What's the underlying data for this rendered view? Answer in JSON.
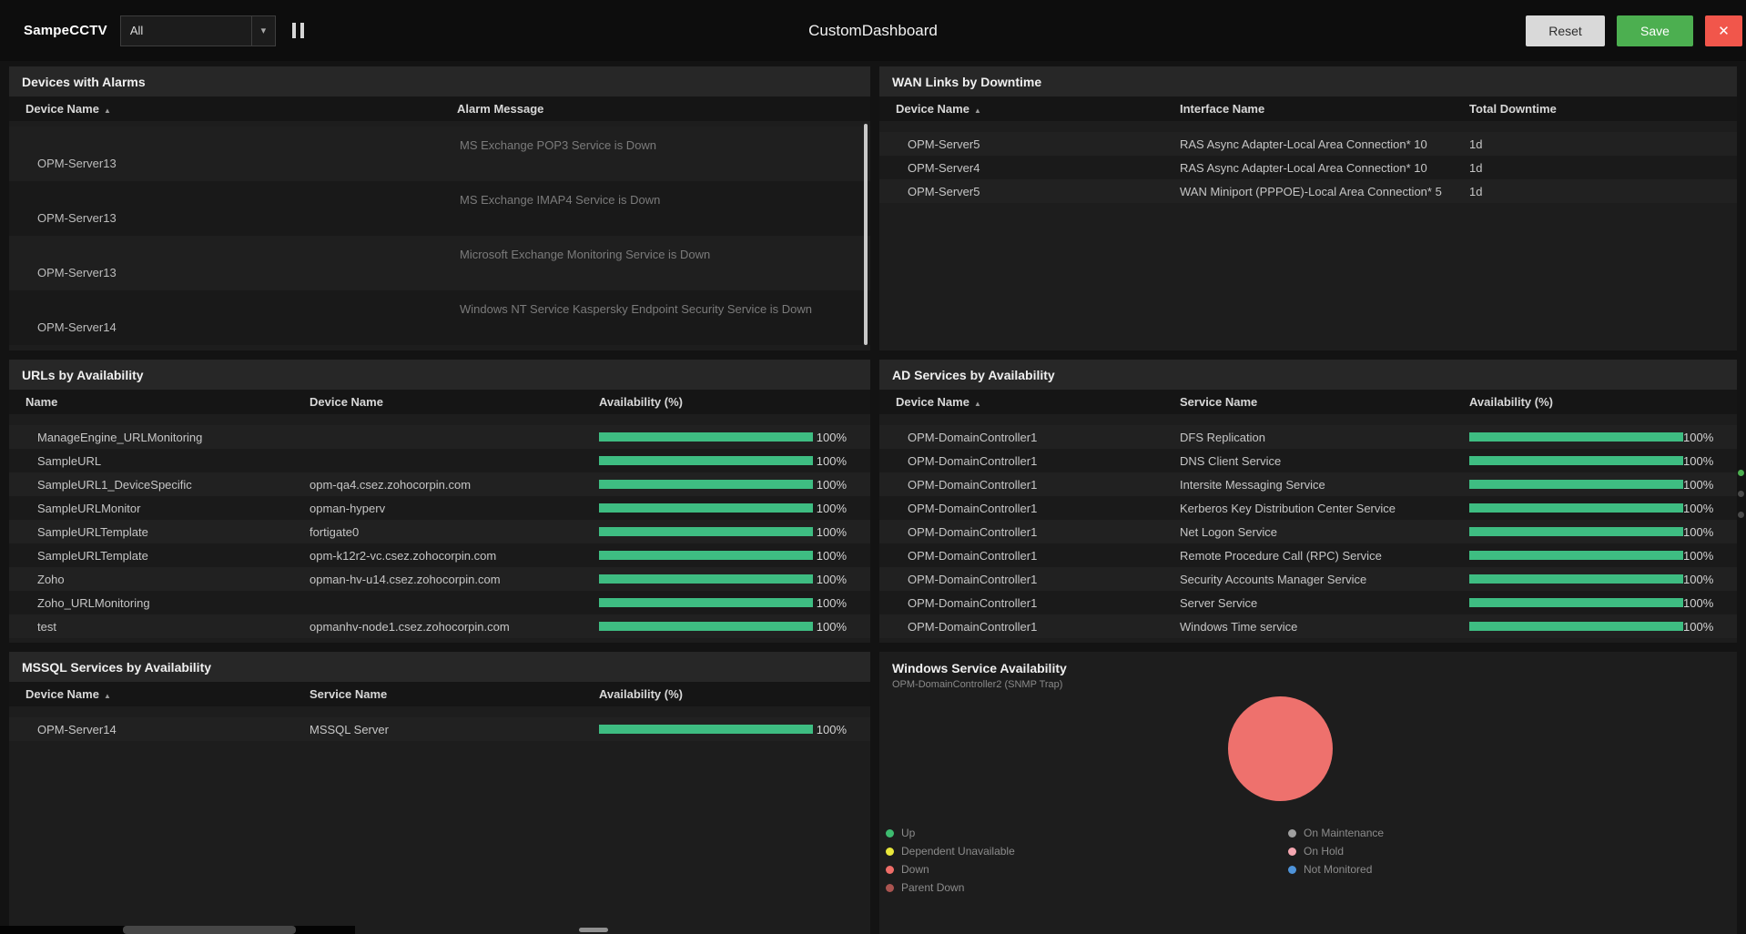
{
  "icons": {
    "sort_asc": "▲",
    "caret_down": "▾",
    "close": "✕"
  },
  "colors": {
    "bar_green": "#3ebd82",
    "save_green": "#4caf50",
    "close_red": "#f1564b",
    "reset_gray": "#d9d9d9"
  },
  "header": {
    "dashboard_name": "SampeCCTV",
    "filter_value": "All",
    "title": "CustomDashboard",
    "reset_label": "Reset",
    "save_label": "Save"
  },
  "panels": {
    "devices": {
      "title": "Devices with Alarms",
      "columns": [
        "Device Name",
        "Alarm Message"
      ],
      "rows": [
        {
          "device": "OPM-Server13",
          "message": "MS Exchange POP3 Service is Down"
        },
        {
          "device": "OPM-Server13",
          "message": "MS Exchange IMAP4 Service is Down"
        },
        {
          "device": "OPM-Server13",
          "message": "Microsoft Exchange Monitoring Service is Down"
        },
        {
          "device": "OPM-Server14",
          "message": "Windows NT Service Kaspersky Endpoint Security Service is Down"
        }
      ]
    },
    "wan": {
      "title": "WAN Links by Downtime",
      "columns": [
        "Device Name",
        "Interface Name",
        "Total Downtime"
      ],
      "rows": [
        {
          "device": "OPM-Server5",
          "interface": "RAS Async Adapter-Local Area Connection* 10",
          "downtime": "1d"
        },
        {
          "device": "OPM-Server4",
          "interface": "RAS Async Adapter-Local Area Connection* 10",
          "downtime": "1d"
        },
        {
          "device": "OPM-Server5",
          "interface": "WAN Miniport (PPPOE)-Local Area Connection* 5",
          "downtime": "1d"
        }
      ]
    },
    "urls": {
      "title": "URLs by Availability",
      "columns": [
        "Name",
        "Device Name",
        "Availability (%)"
      ],
      "rows": [
        {
          "name": "ManageEngine_URLMonitoring",
          "device": "",
          "percent": "100%",
          "value": 100
        },
        {
          "name": "SampleURL",
          "device": "",
          "percent": "100%",
          "value": 100
        },
        {
          "name": "SampleURL1_DeviceSpecific",
          "device": "opm-qa4.csez.zohocorpin.com",
          "percent": "100%",
          "value": 100
        },
        {
          "name": "SampleURLMonitor",
          "device": "opman-hyperv",
          "percent": "100%",
          "value": 100
        },
        {
          "name": "SampleURLTemplate",
          "device": "fortigate0",
          "percent": "100%",
          "value": 100
        },
        {
          "name": "SampleURLTemplate",
          "device": "opm-k12r2-vc.csez.zohocorpin.com",
          "percent": "100%",
          "value": 100
        },
        {
          "name": "Zoho",
          "device": "opman-hv-u14.csez.zohocorpin.com",
          "percent": "100%",
          "value": 100
        },
        {
          "name": "Zoho_URLMonitoring",
          "device": "",
          "percent": "100%",
          "value": 100
        },
        {
          "name": "test",
          "device": "opmanhv-node1.csez.zohocorpin.com",
          "percent": "100%",
          "value": 100
        }
      ]
    },
    "ad": {
      "title": "AD Services by Availability",
      "columns": [
        "Device Name",
        "Service Name",
        "Availability (%)"
      ],
      "rows": [
        {
          "device": "OPM-DomainController1",
          "service": "DFS Replication",
          "percent": "100%",
          "value": 100
        },
        {
          "device": "OPM-DomainController1",
          "service": "DNS Client Service",
          "percent": "100%",
          "value": 100
        },
        {
          "device": "OPM-DomainController1",
          "service": "Intersite Messaging Service",
          "percent": "100%",
          "value": 100
        },
        {
          "device": "OPM-DomainController1",
          "service": "Kerberos Key Distribution Center Service",
          "percent": "100%",
          "value": 100
        },
        {
          "device": "OPM-DomainController1",
          "service": "Net Logon Service",
          "percent": "100%",
          "value": 100
        },
        {
          "device": "OPM-DomainController1",
          "service": "Remote Procedure Call (RPC) Service",
          "percent": "100%",
          "value": 100
        },
        {
          "device": "OPM-DomainController1",
          "service": "Security Accounts Manager Service",
          "percent": "100%",
          "value": 100
        },
        {
          "device": "OPM-DomainController1",
          "service": "Server Service",
          "percent": "100%",
          "value": 100
        },
        {
          "device": "OPM-DomainController1",
          "service": "Windows Time service",
          "percent": "100%",
          "value": 100
        }
      ]
    },
    "mssql": {
      "title": "MSSQL Services by Availability",
      "columns": [
        "Device Name",
        "Service Name",
        "Availability (%)"
      ],
      "rows": [
        {
          "device": "OPM-Server14",
          "service": "MSSQL Server",
          "percent": "100%",
          "value": 100
        }
      ]
    },
    "windows": {
      "title": "Windows Service Availability",
      "subtitle": "OPM-DomainController2 (SNMP Trap)",
      "chart": {
        "type": "pie",
        "slices": [
          {
            "label": "Down",
            "value": 100,
            "color": "#ee716d"
          }
        ]
      },
      "legend": [
        {
          "label": "Up",
          "color": "#3dbb6f"
        },
        {
          "label": "Dependent Unavailable",
          "color": "#e9e73b"
        },
        {
          "label": "Down",
          "color": "#ef6d68"
        },
        {
          "label": "Parent Down",
          "color": "#aa5450"
        },
        {
          "label": "On Maintenance",
          "color": "#a0a0a0"
        },
        {
          "label": "On Hold",
          "color": "#f4a6b0"
        },
        {
          "label": "Not Monitored",
          "color": "#4e93d9"
        }
      ]
    }
  }
}
